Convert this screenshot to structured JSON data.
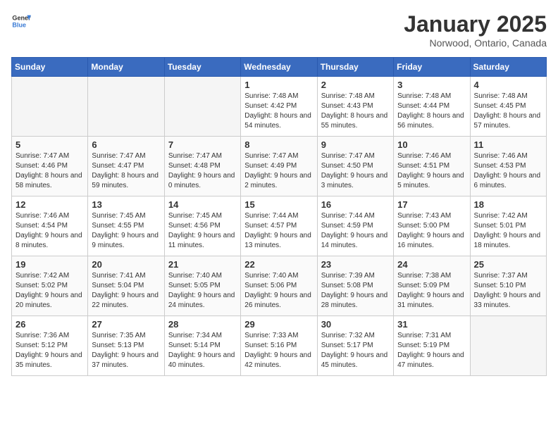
{
  "logo": {
    "text_general": "General",
    "text_blue": "Blue"
  },
  "header": {
    "month": "January 2025",
    "location": "Norwood, Ontario, Canada"
  },
  "days_of_week": [
    "Sunday",
    "Monday",
    "Tuesday",
    "Wednesday",
    "Thursday",
    "Friday",
    "Saturday"
  ],
  "weeks": [
    [
      {
        "day": null,
        "empty": true
      },
      {
        "day": null,
        "empty": true
      },
      {
        "day": null,
        "empty": true
      },
      {
        "day": "1",
        "sunrise": "7:48 AM",
        "sunset": "4:42 PM",
        "daylight": "8 hours and 54 minutes."
      },
      {
        "day": "2",
        "sunrise": "7:48 AM",
        "sunset": "4:43 PM",
        "daylight": "8 hours and 55 minutes."
      },
      {
        "day": "3",
        "sunrise": "7:48 AM",
        "sunset": "4:44 PM",
        "daylight": "8 hours and 56 minutes."
      },
      {
        "day": "4",
        "sunrise": "7:48 AM",
        "sunset": "4:45 PM",
        "daylight": "8 hours and 57 minutes."
      }
    ],
    [
      {
        "day": "5",
        "sunrise": "7:47 AM",
        "sunset": "4:46 PM",
        "daylight": "8 hours and 58 minutes."
      },
      {
        "day": "6",
        "sunrise": "7:47 AM",
        "sunset": "4:47 PM",
        "daylight": "8 hours and 59 minutes."
      },
      {
        "day": "7",
        "sunrise": "7:47 AM",
        "sunset": "4:48 PM",
        "daylight": "9 hours and 0 minutes."
      },
      {
        "day": "8",
        "sunrise": "7:47 AM",
        "sunset": "4:49 PM",
        "daylight": "9 hours and 2 minutes."
      },
      {
        "day": "9",
        "sunrise": "7:47 AM",
        "sunset": "4:50 PM",
        "daylight": "9 hours and 3 minutes."
      },
      {
        "day": "10",
        "sunrise": "7:46 AM",
        "sunset": "4:51 PM",
        "daylight": "9 hours and 5 minutes."
      },
      {
        "day": "11",
        "sunrise": "7:46 AM",
        "sunset": "4:53 PM",
        "daylight": "9 hours and 6 minutes."
      }
    ],
    [
      {
        "day": "12",
        "sunrise": "7:46 AM",
        "sunset": "4:54 PM",
        "daylight": "9 hours and 8 minutes."
      },
      {
        "day": "13",
        "sunrise": "7:45 AM",
        "sunset": "4:55 PM",
        "daylight": "9 hours and 9 minutes."
      },
      {
        "day": "14",
        "sunrise": "7:45 AM",
        "sunset": "4:56 PM",
        "daylight": "9 hours and 11 minutes."
      },
      {
        "day": "15",
        "sunrise": "7:44 AM",
        "sunset": "4:57 PM",
        "daylight": "9 hours and 13 minutes."
      },
      {
        "day": "16",
        "sunrise": "7:44 AM",
        "sunset": "4:59 PM",
        "daylight": "9 hours and 14 minutes."
      },
      {
        "day": "17",
        "sunrise": "7:43 AM",
        "sunset": "5:00 PM",
        "daylight": "9 hours and 16 minutes."
      },
      {
        "day": "18",
        "sunrise": "7:42 AM",
        "sunset": "5:01 PM",
        "daylight": "9 hours and 18 minutes."
      }
    ],
    [
      {
        "day": "19",
        "sunrise": "7:42 AM",
        "sunset": "5:02 PM",
        "daylight": "9 hours and 20 minutes."
      },
      {
        "day": "20",
        "sunrise": "7:41 AM",
        "sunset": "5:04 PM",
        "daylight": "9 hours and 22 minutes."
      },
      {
        "day": "21",
        "sunrise": "7:40 AM",
        "sunset": "5:05 PM",
        "daylight": "9 hours and 24 minutes."
      },
      {
        "day": "22",
        "sunrise": "7:40 AM",
        "sunset": "5:06 PM",
        "daylight": "9 hours and 26 minutes."
      },
      {
        "day": "23",
        "sunrise": "7:39 AM",
        "sunset": "5:08 PM",
        "daylight": "9 hours and 28 minutes."
      },
      {
        "day": "24",
        "sunrise": "7:38 AM",
        "sunset": "5:09 PM",
        "daylight": "9 hours and 31 minutes."
      },
      {
        "day": "25",
        "sunrise": "7:37 AM",
        "sunset": "5:10 PM",
        "daylight": "9 hours and 33 minutes."
      }
    ],
    [
      {
        "day": "26",
        "sunrise": "7:36 AM",
        "sunset": "5:12 PM",
        "daylight": "9 hours and 35 minutes."
      },
      {
        "day": "27",
        "sunrise": "7:35 AM",
        "sunset": "5:13 PM",
        "daylight": "9 hours and 37 minutes."
      },
      {
        "day": "28",
        "sunrise": "7:34 AM",
        "sunset": "5:14 PM",
        "daylight": "9 hours and 40 minutes."
      },
      {
        "day": "29",
        "sunrise": "7:33 AM",
        "sunset": "5:16 PM",
        "daylight": "9 hours and 42 minutes."
      },
      {
        "day": "30",
        "sunrise": "7:32 AM",
        "sunset": "5:17 PM",
        "daylight": "9 hours and 45 minutes."
      },
      {
        "day": "31",
        "sunrise": "7:31 AM",
        "sunset": "5:19 PM",
        "daylight": "9 hours and 47 minutes."
      },
      {
        "day": null,
        "empty": true
      }
    ]
  ],
  "labels": {
    "sunrise": "Sunrise:",
    "sunset": "Sunset:",
    "daylight": "Daylight:"
  }
}
